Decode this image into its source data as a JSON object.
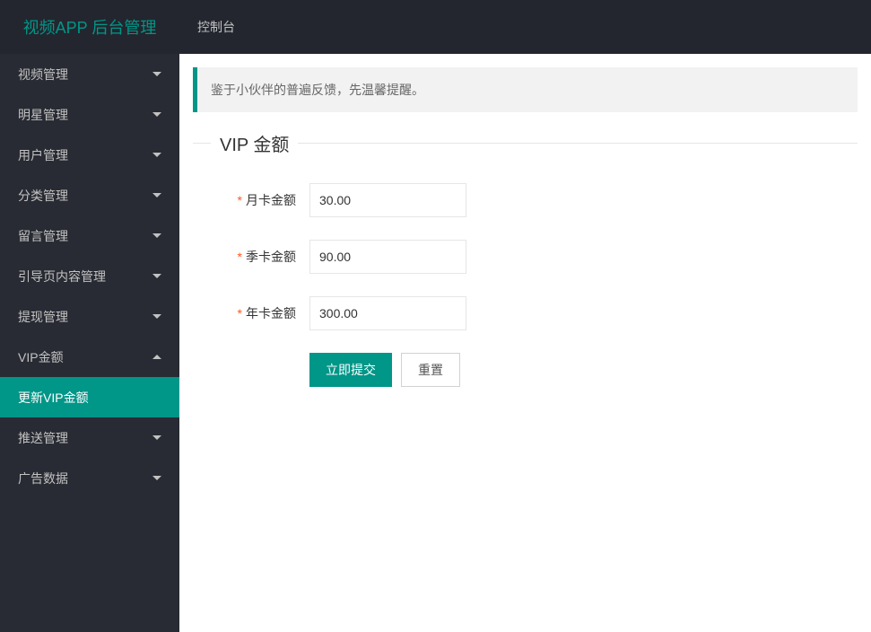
{
  "header": {
    "logo": "视频APP 后台管理",
    "nav_console": "控制台"
  },
  "sidebar": {
    "items": [
      {
        "label": "视频管理",
        "expanded": false
      },
      {
        "label": "明星管理",
        "expanded": false
      },
      {
        "label": "用户管理",
        "expanded": false
      },
      {
        "label": "分类管理",
        "expanded": false
      },
      {
        "label": "留言管理",
        "expanded": false
      },
      {
        "label": "引导页内容管理",
        "expanded": false
      },
      {
        "label": "提现管理",
        "expanded": false
      },
      {
        "label": "VIP金额",
        "expanded": true
      },
      {
        "label": "推送管理",
        "expanded": false
      },
      {
        "label": "广告数据",
        "expanded": false
      }
    ],
    "sub_active": "更新VIP金额"
  },
  "main": {
    "alert": "鉴于小伙伴的普遍反馈，先温馨提醒。",
    "legend": "VIP 金额",
    "fields": {
      "month_label": "月卡金额",
      "month_value": "30.00",
      "quarter_label": "季卡金额",
      "quarter_value": "90.00",
      "year_label": "年卡金额",
      "year_value": "300.00"
    },
    "buttons": {
      "submit": "立即提交",
      "reset": "重置"
    }
  }
}
